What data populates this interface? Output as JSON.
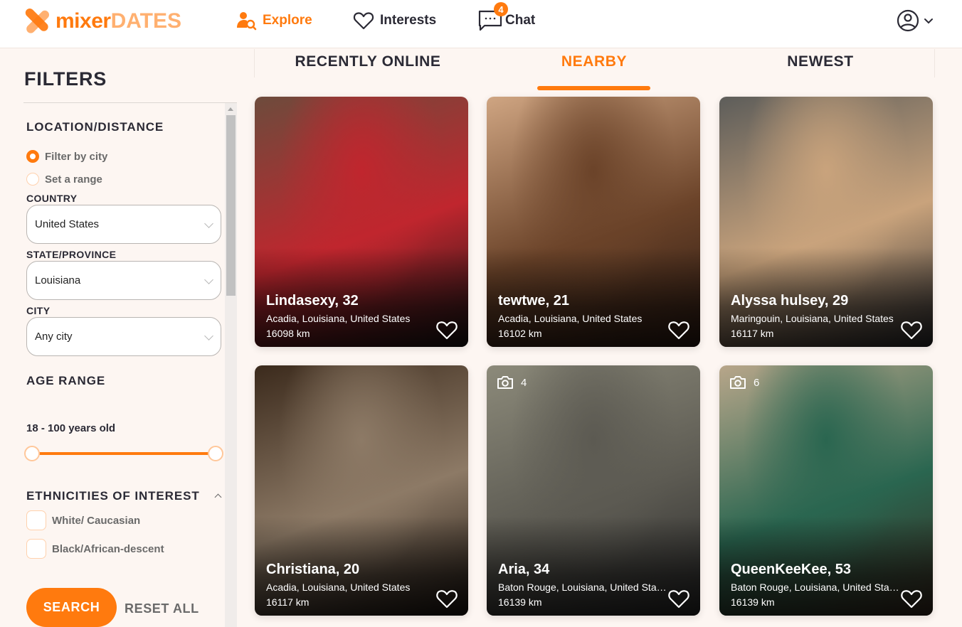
{
  "brand": {
    "name_part1": "mixer",
    "name_part2": "DATES",
    "primary_color": "#ff7a0e",
    "light_color": "#ffb070"
  },
  "nav": {
    "items": [
      {
        "label": "Explore",
        "icon": "user-search-icon",
        "active": true
      },
      {
        "label": "Interests",
        "icon": "heart-icon",
        "active": false
      },
      {
        "label": "Chat",
        "icon": "chat-bubble-icon",
        "active": false,
        "badge": "4"
      }
    ],
    "account_icon": "user-circle-icon",
    "account_chevron": "chevron-down-icon"
  },
  "sidebar": {
    "title": "FILTERS",
    "location": {
      "title": "LOCATION/DISTANCE",
      "options": [
        {
          "label": "Filter by city",
          "selected": true
        },
        {
          "label": "Set a range",
          "selected": false
        }
      ],
      "country_label": "COUNTRY",
      "country_value": "United States",
      "state_label": "STATE/PROVINCE",
      "state_value": "Louisiana",
      "city_label": "CITY",
      "city_value": "Any city"
    },
    "age": {
      "title": "AGE RANGE",
      "text": "18 - 100 years old",
      "min": 18,
      "max": 100
    },
    "ethnicities": {
      "title": "ETHNICITIES OF INTEREST",
      "options": [
        {
          "label": "White/ Caucasian",
          "checked": false
        },
        {
          "label": "Black/African-descent",
          "checked": false
        }
      ]
    },
    "search_label": "SEARCH",
    "reset_label": "RESET ALL"
  },
  "tabs": [
    {
      "label": "RECENTLY ONLINE",
      "active": false
    },
    {
      "label": "NEARBY",
      "active": true
    },
    {
      "label": "NEWEST",
      "active": false
    }
  ],
  "profiles": [
    {
      "name": "Lindasexy, 32",
      "location": "Acadia, Louisiana, United States",
      "distance": "16098 km",
      "photo_count": null,
      "colors": [
        "#6d4b3c",
        "#c0262e",
        "#1a1414"
      ]
    },
    {
      "name": "tewtwe, 21",
      "location": "Acadia, Louisiana, United States",
      "distance": "16102 km",
      "photo_count": null,
      "colors": [
        "#cfa582",
        "#6b4329",
        "#2c1a12"
      ]
    },
    {
      "name": "Alyssa hulsey, 29",
      "location": "Maringouin, Louisiana, United States",
      "distance": "16117 km",
      "photo_count": null,
      "colors": [
        "#5d5d5a",
        "#c9a37c",
        "#2e2e30"
      ]
    },
    {
      "name": "Christiana, 20",
      "location": "Acadia, Louisiana, United States",
      "distance": "16117 km",
      "photo_count": null,
      "colors": [
        "#3b2a1c",
        "#8d7a66",
        "#1d1510"
      ]
    },
    {
      "name": "Aria, 34",
      "location": "Baton Rouge, Louisiana, United States",
      "distance": "16139 km",
      "photo_count": "4",
      "colors": [
        "#8c8a7a",
        "#5c5a52",
        "#2a2a2a"
      ]
    },
    {
      "name": "QueenKeeKee, 53",
      "location": "Baton Rouge, Louisiana, United States",
      "distance": "16139 km",
      "photo_count": "6",
      "colors": [
        "#b8a68a",
        "#2a6650",
        "#3a2a1f"
      ]
    }
  ]
}
